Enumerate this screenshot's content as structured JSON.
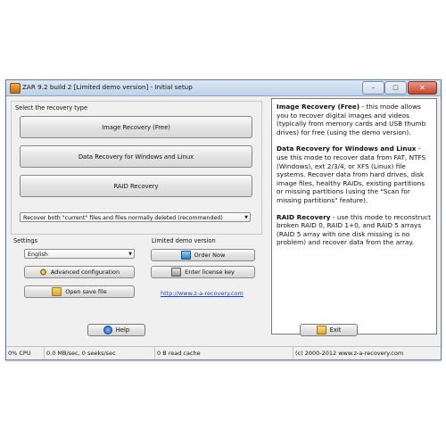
{
  "window": {
    "title": "ZAR 9.2 build 2 [Limited demo version] - Initial setup",
    "controls": {
      "minimize": "–",
      "maximize": "□",
      "close": "✕"
    }
  },
  "recovery": {
    "group_label": "Select the recovery type",
    "image_recovery_button": "Image Recovery (Free)",
    "data_recovery_button": "Data Recovery for Windows and Linux",
    "raid_recovery_button": "RAID Recovery",
    "mode_select_value": "Recover both \"current\" files and files normally deleted (recommended)"
  },
  "settings": {
    "group_label": "Settings",
    "language_value": "English",
    "advanced_button": "Advanced configuration",
    "open_save_button": "Open save file"
  },
  "demo": {
    "group_label": "Limited demo version",
    "order_button": "Order Now",
    "license_button": "Enter license key",
    "link_text": "http://www.z-a-recovery.com"
  },
  "info": {
    "image_title": "Image Recovery (Free)",
    "image_text": " - this mode allows you to recover digital images and videos (typically from memory cards and USB thumb drives) for free (using the demo version).",
    "data_title": "Data Recovery for Windows and Linux",
    "data_text": " - use this mode to recover data from FAT, NTFS (Windows), ext 2/3/4, or XFS (Linux) file systems. Recover data from hard drives, disk image files, healthy RAIDs, existing partitions or missing partitions (using the \"Scan for missing partitions\" feature).",
    "raid_title": "RAID Recovery",
    "raid_text": " - use this mode to reconstruct broken RAID 0, RAID 1+0, and RAID 5 arrays (RAID 5 array with one disk missing is no problem) and recover data from the array."
  },
  "actions": {
    "help_button": "Help",
    "exit_button": "Exit"
  },
  "status": {
    "cpu": "0% CPU",
    "throughput": "0.0 MB/sec, 0 seeks/sec",
    "cache": "0 B read cache",
    "copyright": "(c) 2000-2012 www.z-a-recovery.com"
  },
  "colors": {
    "link": "#1a3fd0",
    "title_gradient_top": "#dce8f5",
    "close_red": "#c7432a"
  },
  "icons": [
    "app-icon",
    "gear-icon",
    "folder-icon",
    "cart-icon",
    "key-icon",
    "help-icon",
    "exit-icon"
  ]
}
